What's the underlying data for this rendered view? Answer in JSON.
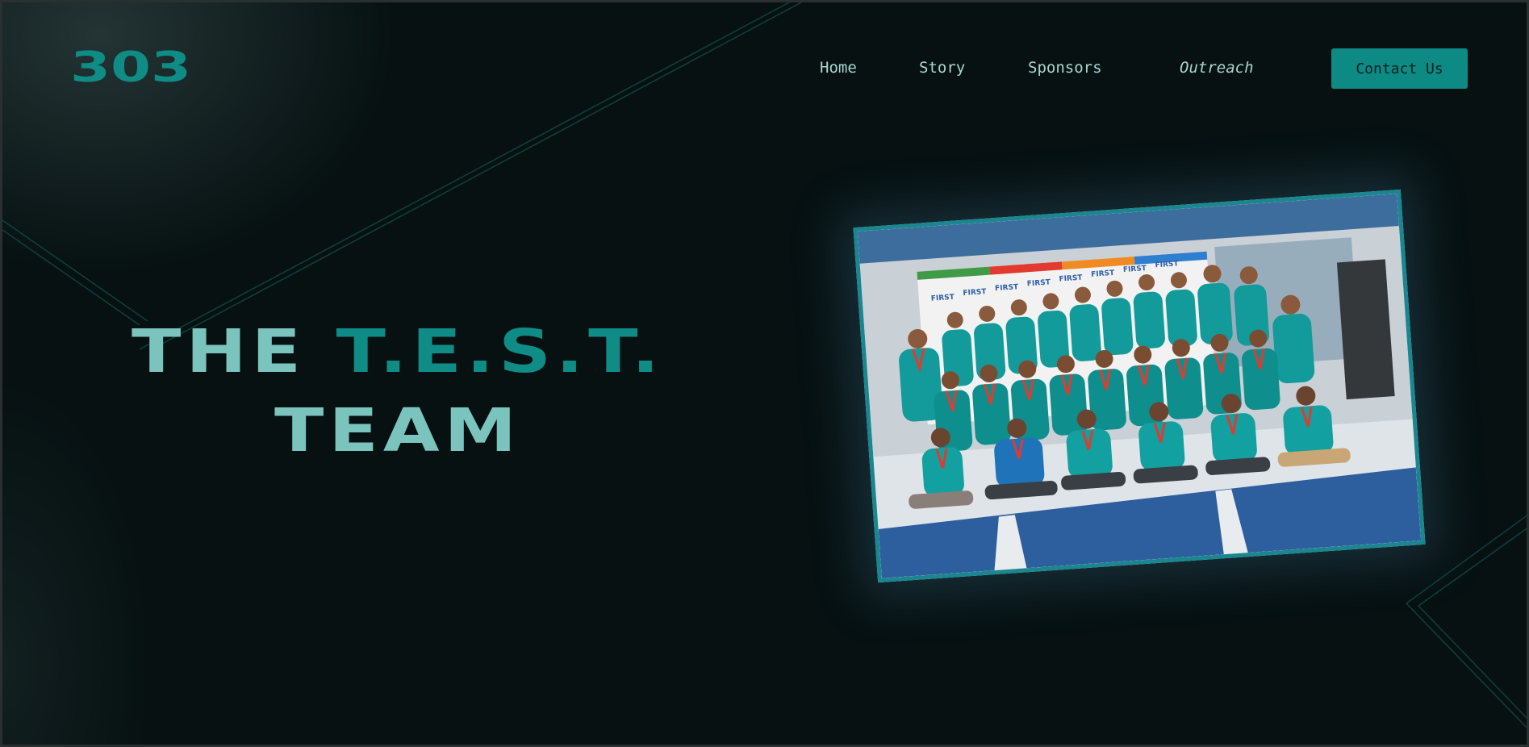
{
  "header": {
    "logo_text": "303",
    "nav": [
      {
        "label": "Home"
      },
      {
        "label": "Story"
      },
      {
        "label": "Sponsors"
      },
      {
        "label": "Outreach"
      }
    ],
    "contact_label": "Contact Us"
  },
  "hero": {
    "title_part1": "THE ",
    "title_accent": "T.E.S.T.",
    "title_line2": "TEAM"
  },
  "photo": {
    "alt": "Team group photo",
    "banner_text": "FIRST"
  },
  "colors": {
    "background": "#071112",
    "accent": "#0e8a85",
    "title_light": "#7bc3bd",
    "nav_text": "#a9d6d2",
    "photo_border": "#1a8690"
  }
}
